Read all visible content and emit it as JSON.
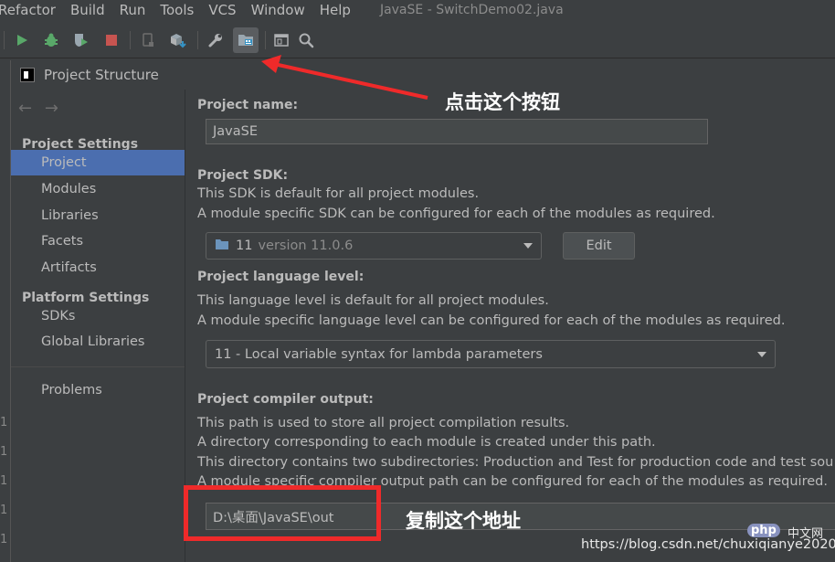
{
  "menubar": {
    "items": [
      "Refactor",
      "Build",
      "Run",
      "Tools",
      "VCS",
      "Window",
      "Help"
    ],
    "window_title": "JavaSE - SwitchDemo02.java"
  },
  "toolbar": {
    "icons": [
      "run-icon",
      "debug-icon",
      "coverage-icon",
      "stop-icon",
      "device-icon",
      "build-icon",
      "settings-wrench-icon",
      "project-structure-icon",
      "terminal-icon",
      "search-icon"
    ]
  },
  "dialog": {
    "title": "Project Structure",
    "sidebar": {
      "project_settings_header": "Project Settings",
      "project_settings_items": [
        "Project",
        "Modules",
        "Libraries",
        "Facets",
        "Artifacts"
      ],
      "platform_settings_header": "Platform Settings",
      "platform_settings_items": [
        "SDKs",
        "Global Libraries"
      ],
      "problems": "Problems",
      "selected": "Project"
    },
    "content": {
      "project_name_label": "Project name:",
      "project_name_value": "JavaSE",
      "sdk_label": "Project SDK:",
      "sdk_desc1": "This SDK is default for all project modules.",
      "sdk_desc2": "A module specific SDK can be configured for each of the modules as required.",
      "sdk_combo_name": "11",
      "sdk_combo_version": "version 11.0.6",
      "edit_button": "Edit",
      "lang_label": "Project language level:",
      "lang_desc1": "This language level is default for all project modules.",
      "lang_desc2": "A module specific language level can be configured for each of the modules as required.",
      "lang_combo_value": "11 - Local variable syntax for lambda parameters",
      "compiler_label": "Project compiler output:",
      "compiler_desc1": "This path is used to store all project compilation results.",
      "compiler_desc2": "A directory corresponding to each module is created under this path.",
      "compiler_desc3": "This directory contains two subdirectories: Production and Test for production code and test sou",
      "compiler_desc4": "A module specific compiler output path can be configured for each of the modules as required.",
      "compiler_output_value": "D:\\桌面\\JavaSE\\out"
    }
  },
  "annotations": {
    "click_button": "点击这个按钮",
    "copy_address": "复制这个地址",
    "accent_color": "#ef2a2a"
  },
  "watermark": {
    "php_logo": "php",
    "php_cn": "中文网",
    "url": "https://blog.csdn.net/chuxiqianye2020"
  }
}
